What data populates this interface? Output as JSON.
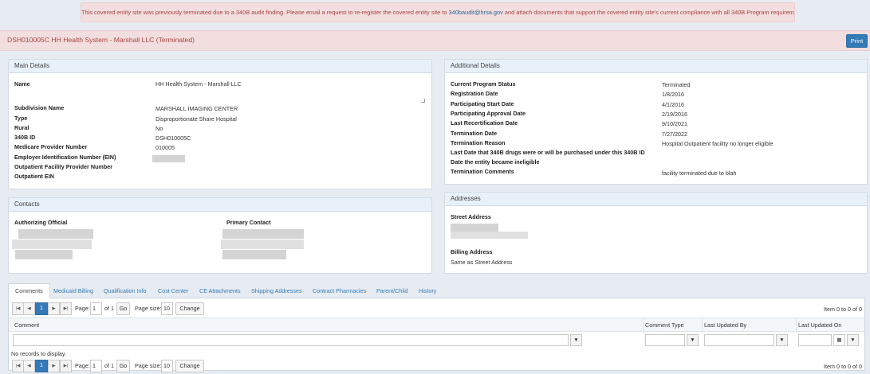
{
  "alert": {
    "text_before": "This covered entity site was previously terminated due to a 340B audit finding. Please email a request to re-register the covered entity site to",
    "email": "340baudit@hrsa.gov",
    "text_after": "and attach documents that support the covered entity site's current compliance with all 340B Program requirements."
  },
  "header": {
    "title": "DSH010005C HH Health System - Marshall LLC (Terminated)",
    "print_label": "Print"
  },
  "main_details": {
    "heading": "Main Details",
    "name_label": "Name",
    "name_value": "HH Health System - Marshall LLC",
    "fields": [
      {
        "label": "Subdivision Name",
        "value": "MARSHALL IMAGING CENTER"
      },
      {
        "label": "Type",
        "value": "Disproportionate Share Hospital"
      },
      {
        "label": "Rural",
        "value": "No"
      },
      {
        "label": "340B ID",
        "value": "DSH010005C"
      },
      {
        "label": "Medicare Provider Number",
        "value": "010005"
      },
      {
        "label": "Employer Identification Number (EIN)",
        "value": ""
      },
      {
        "label": "Outpatient Facility Provider Number",
        "value": ""
      },
      {
        "label": "Outpatient EIN",
        "value": ""
      }
    ]
  },
  "additional_details": {
    "heading": "Additional Details",
    "fields": [
      {
        "label": "Current Program Status",
        "value": "Terminated"
      },
      {
        "label": "Registration Date",
        "value": "1/8/2016"
      },
      {
        "label": "Participating Start Date",
        "value": "4/1/2016"
      },
      {
        "label": "Participating Approval Date",
        "value": "2/19/2016"
      },
      {
        "label": "Last Recertification Date",
        "value": "9/10/2021"
      },
      {
        "label": "Termination Date",
        "value": "7/27/2022"
      },
      {
        "label": "Termination Reason",
        "value": "Hospital Outpatient facility no longer eligible"
      },
      {
        "label": "Last Date that 340B drugs were or will be purchased under this 340B ID",
        "value": ""
      },
      {
        "label": "Date the entity became ineligible",
        "value": ""
      },
      {
        "label": "Termination Comments",
        "value": "facility terminated due to blah"
      }
    ]
  },
  "contacts": {
    "heading": "Contacts",
    "authorizing_label": "Authorizing Official",
    "primary_label": "Primary Contact"
  },
  "addresses": {
    "heading": "Addresses",
    "street_label": "Street Address",
    "billing_label": "Billing Address",
    "billing_value": "Same as Street Address"
  },
  "tabs": [
    {
      "label": "Comments",
      "active": true
    },
    {
      "label": "Medicaid Billing"
    },
    {
      "label": "Qualification Info"
    },
    {
      "label": "Cost Center"
    },
    {
      "label": "CE Attachments"
    },
    {
      "label": "Shipping Addresses"
    },
    {
      "label": "Contract Pharmacies"
    },
    {
      "label": "Parent/Child"
    },
    {
      "label": "History"
    }
  ],
  "pager": {
    "current_page": "1",
    "page_label": "Page:",
    "page_value": "1",
    "of_label": "of 1",
    "go_label": "Go",
    "size_label": "Page size:",
    "size_value": "10",
    "change_label": "Change",
    "items_text": "Item 0 to 0 of 0"
  },
  "grid": {
    "columns": [
      "Comment",
      "Comment Type",
      "Last Updated By",
      "Last Updated On"
    ],
    "no_records": "No records to display."
  }
}
